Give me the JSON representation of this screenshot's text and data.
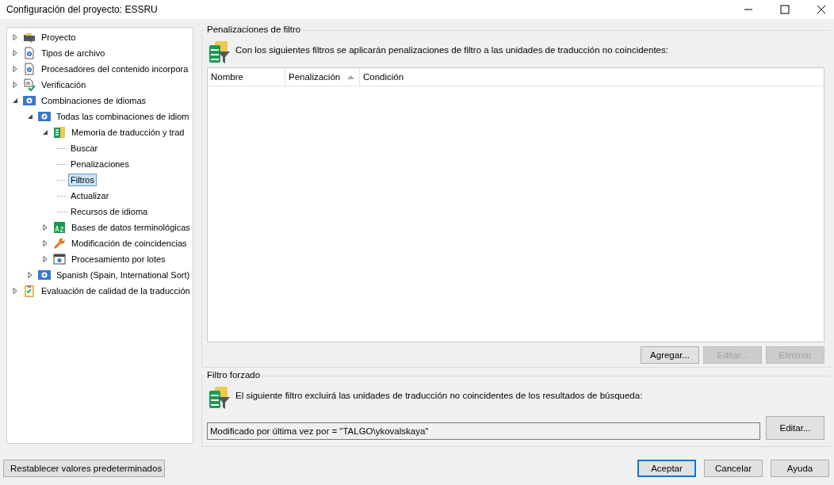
{
  "window": {
    "title": "Configuración del proyecto: ESSRU"
  },
  "tree": [
    {
      "label": "Proyecto",
      "kind": "project",
      "expanded": false,
      "selected": false
    },
    {
      "label": "Tipos de archivo",
      "kind": "settings",
      "expanded": false,
      "selected": false
    },
    {
      "label": "Procesadores del contenido incorpora",
      "kind": "settings",
      "expanded": false,
      "selected": false
    },
    {
      "label": "Verificación",
      "kind": "verify",
      "expanded": false,
      "selected": false
    },
    {
      "label": "Combinaciones de idiomas",
      "kind": "language",
      "expanded": true,
      "selected": false,
      "children": [
        {
          "label": "Todas las combinaciones de idiom",
          "kind": "language",
          "expanded": true,
          "selected": false,
          "children": [
            {
              "label": "Memoria de traducción y trad",
              "kind": "memory",
              "expanded": true,
              "selected": false,
              "children": [
                {
                  "label": "Buscar",
                  "kind": "leaf",
                  "selected": false
                },
                {
                  "label": "Penalizaciones",
                  "kind": "leaf",
                  "selected": false
                },
                {
                  "label": "Filtros",
                  "kind": "leaf",
                  "selected": true
                },
                {
                  "label": "Actualizar",
                  "kind": "leaf",
                  "selected": false
                },
                {
                  "label": "Recursos de idioma",
                  "kind": "leaf",
                  "selected": false
                }
              ]
            },
            {
              "label": "Bases de datos terminológicas",
              "kind": "termbase",
              "expanded": false,
              "selected": false
            },
            {
              "label": "Modificación de coincidencias",
              "kind": "wrench",
              "expanded": false,
              "selected": false
            },
            {
              "label": "Procesamiento por lotes",
              "kind": "batch",
              "expanded": false,
              "selected": false
            }
          ]
        },
        {
          "label": "Spanish (Spain, International Sort)",
          "kind": "language",
          "expanded": false,
          "selected": false
        }
      ]
    },
    {
      "label": "Evaluación de calidad de la traducción",
      "kind": "quality",
      "expanded": false,
      "selected": false
    }
  ],
  "penalties": {
    "title": "Penalizaciones de filtro",
    "description": "Con los siguientes filtros se aplicarán penalizaciones de filtro a las unidades de traducción no coincidentes:",
    "columns": [
      {
        "label": "Nombre",
        "sorted": false
      },
      {
        "label": "Penalización",
        "sorted": true
      },
      {
        "label": "Condición",
        "sorted": false
      }
    ],
    "buttons": [
      {
        "label": "Agregar...",
        "disabled": false
      },
      {
        "label": "Editar...",
        "disabled": true
      },
      {
        "label": "Eliminar",
        "disabled": true
      }
    ]
  },
  "forced_filter": {
    "title": "Filtro forzado",
    "description": "El siguiente filtro excluirá las unidades de traducción no coincidentes de los resultados de búsqueda:",
    "value": "Modificado por última vez por = \"TALGO\\ykovalskaya\"",
    "button": "Editar..."
  },
  "footer": {
    "reset": "Restablecer valores predeterminados",
    "buttons": [
      {
        "label": "Aceptar",
        "default": true
      },
      {
        "label": "Cancelar",
        "default": false
      },
      {
        "label": "Ayuda",
        "default": false
      }
    ]
  }
}
